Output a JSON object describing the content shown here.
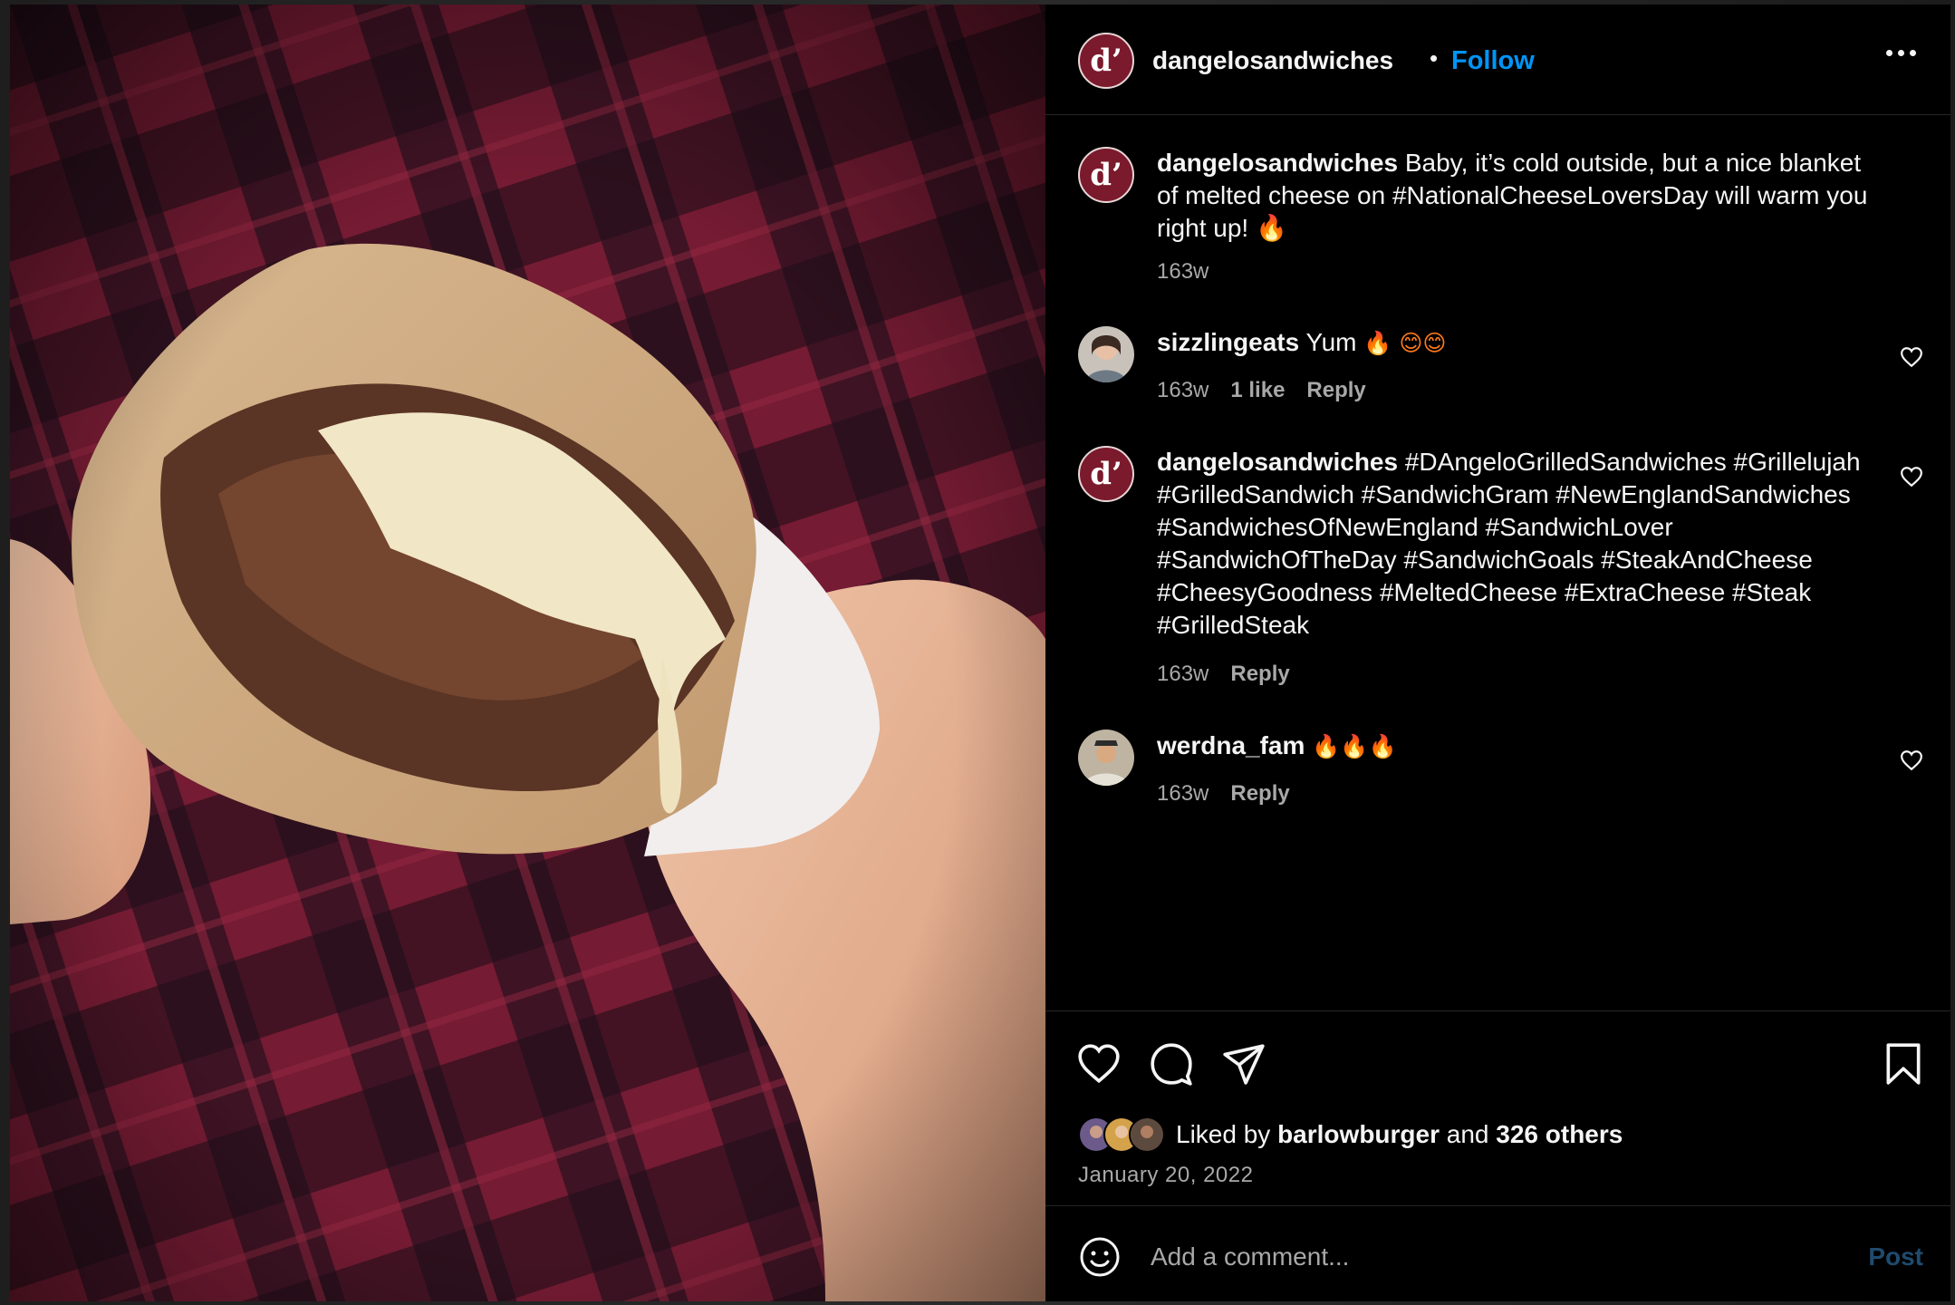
{
  "post": {
    "username": "dangelosandwiches",
    "follow_label": "Follow",
    "separator": "•",
    "avatar_letter": "d’"
  },
  "caption": {
    "username": "dangelosandwiches",
    "text": "Baby, it’s cold outside, but a nice blanket of melted cheese on #NationalCheeseLoversDay will warm you right up! 🔥",
    "time": "163w"
  },
  "comments": [
    {
      "username": "sizzlingeats",
      "text": "Yum",
      "emoji": "🔥 😊😊",
      "time": "163w",
      "likes": "1 like",
      "reply": "Reply"
    },
    {
      "username": "dangelosandwiches",
      "text": "#DAngeloGrilledSandwiches #Grillelujah #GrilledSandwich #SandwichGram #NewEnglandSandwiches #SandwichesOfNewEngland #SandwichLover #SandwichOfTheDay #SandwichGoals #SteakAndCheese #CheesyGoodness #MeltedCheese #ExtraCheese #Steak #GrilledSteak",
      "time": "163w",
      "reply": "Reply"
    },
    {
      "username": "werdna_fam",
      "emoji": "🔥🔥🔥",
      "time": "163w",
      "reply": "Reply"
    }
  ],
  "likes": {
    "prefix": "Liked by",
    "user": "barlowburger",
    "and": "and",
    "others": "326 others"
  },
  "date": "January 20, 2022",
  "add_comment": {
    "placeholder": "Add a comment...",
    "post_label": "Post"
  },
  "icons": [
    "like-icon",
    "comment-icon",
    "share-icon",
    "bookmark-icon",
    "more-icon",
    "emoji-icon",
    "heart-small-icon"
  ],
  "colors": {
    "follow": "#0095f6",
    "background": "#000000",
    "muted": "#a8a8a8",
    "brand": "#7b1a2c"
  }
}
